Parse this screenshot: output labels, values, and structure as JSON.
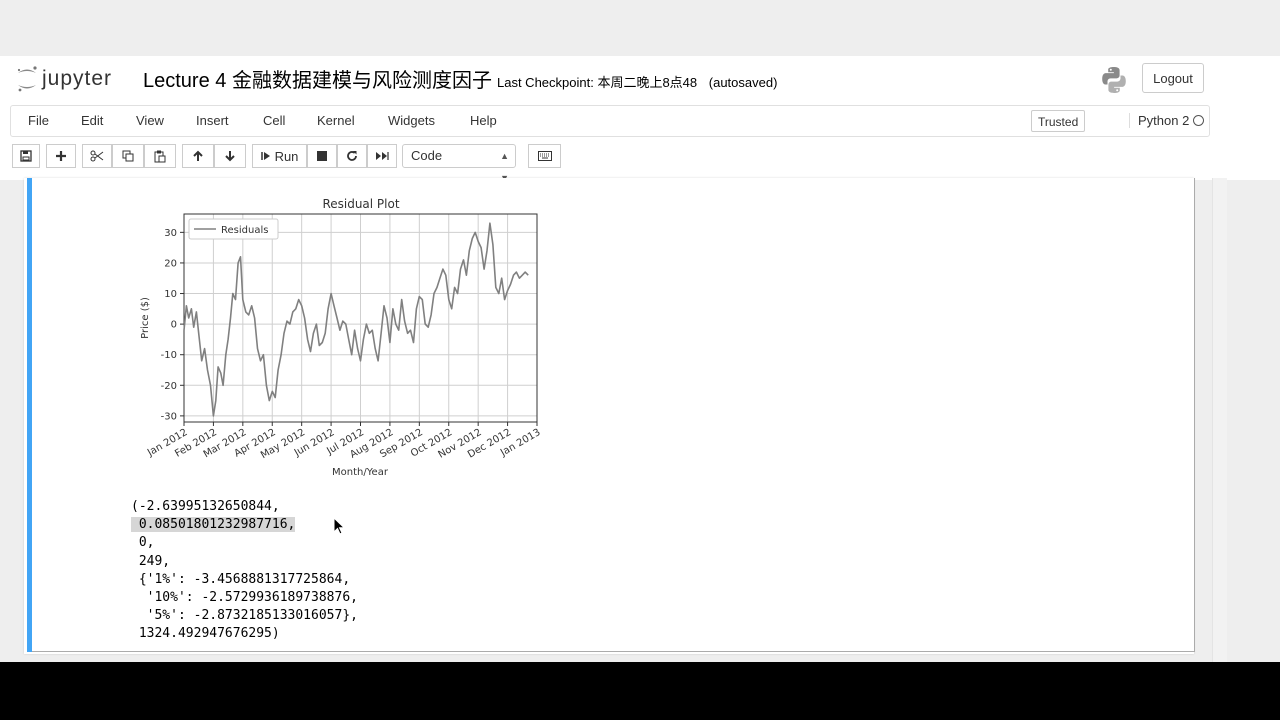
{
  "app": {
    "logo_text": "jupyter",
    "notebook_title": "Lecture 4 金融数据建模与风险测度因子",
    "checkpoint_label": "Last Checkpoint: 本周二晚上8点48",
    "autosave_status": "(autosaved)",
    "logout_label": "Logout"
  },
  "menu": {
    "items": [
      "File",
      "Edit",
      "View",
      "Insert",
      "Cell",
      "Kernel",
      "Widgets",
      "Help"
    ],
    "trusted_label": "Trusted",
    "kernel_name": "Python 2"
  },
  "toolbar": {
    "run_label": "Run",
    "cell_type": "Code",
    "icons": [
      "save-icon",
      "plus-icon",
      "cut-icon",
      "copy-icon",
      "paste-icon",
      "arrow-up-icon",
      "arrow-down-icon",
      "run-icon",
      "stop-icon",
      "restart-icon",
      "fast-forward-icon",
      "keyboard-icon"
    ]
  },
  "colors": {
    "cell_selected_bar": "#42a5f5",
    "series_line": "#808080",
    "highlight": "#d6d6d6"
  },
  "chart_data": {
    "type": "line",
    "title": "Residual Plot",
    "xlabel": "Month/Year",
    "ylabel": "Price ($)",
    "ylim": [
      -32,
      36
    ],
    "yticks": [
      -30,
      -20,
      -10,
      0,
      10,
      20,
      30
    ],
    "xticks": [
      "Jan 2012",
      "Feb 2012",
      "Mar 2012",
      "Apr 2012",
      "May 2012",
      "Jun 2012",
      "Jul 2012",
      "Aug 2012",
      "Sep 2012",
      "Oct 2012",
      "Nov 2012",
      "Dec 2012",
      "Jan 2013"
    ],
    "grid": true,
    "legend_position": "top-left",
    "series": [
      {
        "name": "Residuals",
        "x_months": [
          0,
          0.08,
          0.16,
          0.25,
          0.33,
          0.42,
          0.5,
          0.6,
          0.7,
          0.8,
          0.9,
          1.0,
          1.08,
          1.16,
          1.25,
          1.33,
          1.42,
          1.5,
          1.58,
          1.66,
          1.75,
          1.84,
          1.92,
          2.0,
          2.1,
          2.2,
          2.3,
          2.4,
          2.5,
          2.6,
          2.7,
          2.8,
          2.9,
          3.0,
          3.1,
          3.2,
          3.3,
          3.4,
          3.5,
          3.6,
          3.7,
          3.8,
          3.9,
          4.0,
          4.1,
          4.2,
          4.3,
          4.4,
          4.5,
          4.6,
          4.7,
          4.8,
          4.9,
          5.0,
          5.1,
          5.2,
          5.3,
          5.4,
          5.5,
          5.6,
          5.7,
          5.8,
          5.9,
          6.0,
          6.1,
          6.2,
          6.3,
          6.4,
          6.5,
          6.6,
          6.7,
          6.8,
          6.9,
          7.0,
          7.1,
          7.2,
          7.3,
          7.4,
          7.5,
          7.6,
          7.7,
          7.8,
          7.9,
          8.0,
          8.1,
          8.2,
          8.3,
          8.4,
          8.5,
          8.6,
          8.7,
          8.8,
          8.9,
          9.0,
          9.1,
          9.2,
          9.3,
          9.4,
          9.5,
          9.6,
          9.7,
          9.8,
          9.9,
          10.0,
          10.1,
          10.2,
          10.3,
          10.4,
          10.5,
          10.6,
          10.7,
          10.8,
          10.9,
          11.0,
          11.1,
          11.2,
          11.3,
          11.4,
          11.5,
          11.6,
          11.7,
          11.8,
          11.9,
          12.0
        ],
        "values": [
          -2,
          6,
          2,
          5,
          -1,
          4,
          -3,
          -12,
          -8,
          -15,
          -20,
          -30,
          -25,
          -14,
          -16,
          -20,
          -10,
          -5,
          2,
          10,
          8,
          20,
          22,
          8,
          4,
          3,
          6,
          2,
          -8,
          -12,
          -10,
          -20,
          -25,
          -22,
          -24,
          -15,
          -10,
          -3,
          1,
          0,
          4,
          5,
          8,
          6,
          2,
          -5,
          -9,
          -3,
          0,
          -7,
          -6,
          -3,
          5,
          10,
          6,
          2,
          -2,
          1,
          0,
          -5,
          -10,
          -2,
          -8,
          -12,
          -5,
          0,
          -3,
          -2,
          -8,
          -12,
          -3,
          6,
          2,
          -6,
          5,
          0,
          -2,
          8,
          1,
          -3,
          -2,
          -6,
          5,
          9,
          8,
          0,
          -1,
          3,
          10,
          12,
          15,
          18,
          16,
          8,
          5,
          12,
          10,
          18,
          21,
          16,
          24,
          28,
          30,
          27,
          25,
          18,
          24,
          33,
          26,
          12,
          10,
          15,
          8,
          11,
          13,
          16,
          17,
          15,
          16,
          17,
          16
        ]
      }
    ]
  },
  "output": {
    "lines": [
      "(-2.63995132650844,",
      " 0.08501801232987716,",
      " 0,",
      " 249,",
      " {'1%': -3.4568881317725864,",
      "  '10%': -2.5729936189738876,",
      "  '5%': -2.8732185133016057},",
      " 1324.492947676295)"
    ]
  }
}
